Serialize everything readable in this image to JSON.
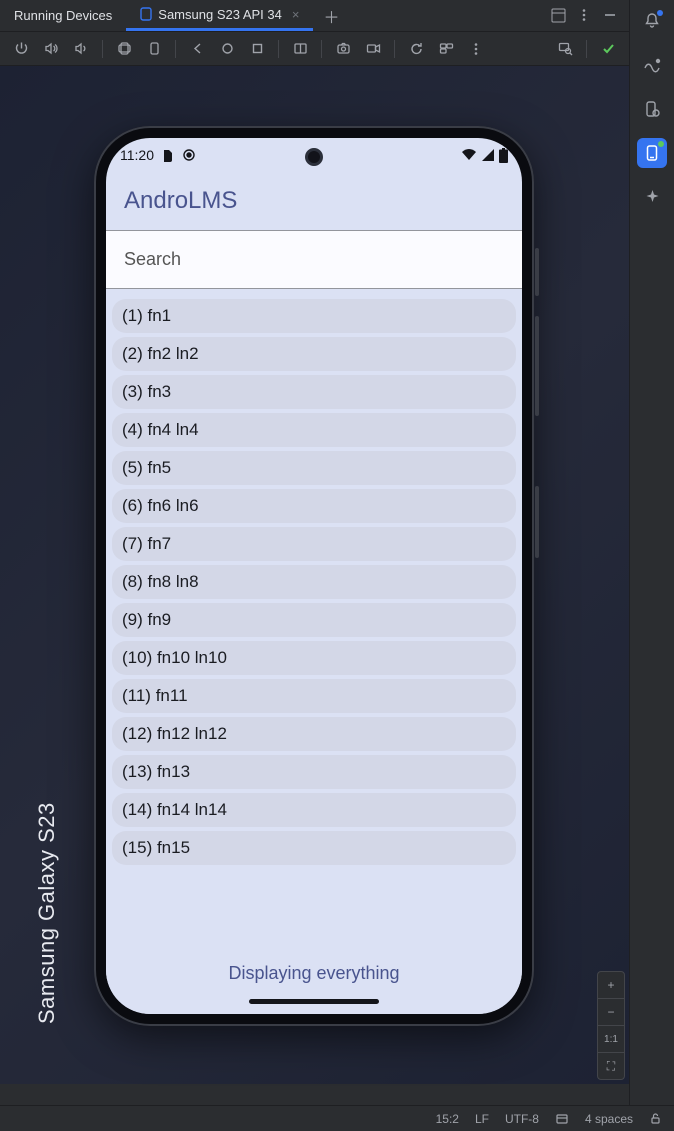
{
  "tabs": {
    "tool_window_title": "Running Devices",
    "active_tab": "Samsung S23 API 34"
  },
  "device_label": "Samsung Galaxy  S23",
  "phone": {
    "clock": "11:20",
    "app_title": "AndroLMS",
    "search_placeholder": "Search",
    "rows": [
      "(1) fn1",
      "(2) fn2 ln2",
      "(3) fn3",
      "(4) fn4 ln4",
      "(5) fn5",
      "(6) fn6 ln6",
      "(7) fn7",
      "(8) fn8 ln8",
      "(9) fn9",
      "(10) fn10 ln10",
      "(11) fn11",
      "(12) fn12 ln12",
      "(13) fn13",
      "(14) fn14 ln14",
      "(15) fn15"
    ],
    "footer": "Displaying everything"
  },
  "zoom": {
    "in": "+",
    "out": "−",
    "reset": "1:1",
    "fit": "⛶"
  },
  "status": {
    "caret": "15:2",
    "eol": "LF",
    "encoding": "UTF-8",
    "indent": "4 spaces"
  }
}
